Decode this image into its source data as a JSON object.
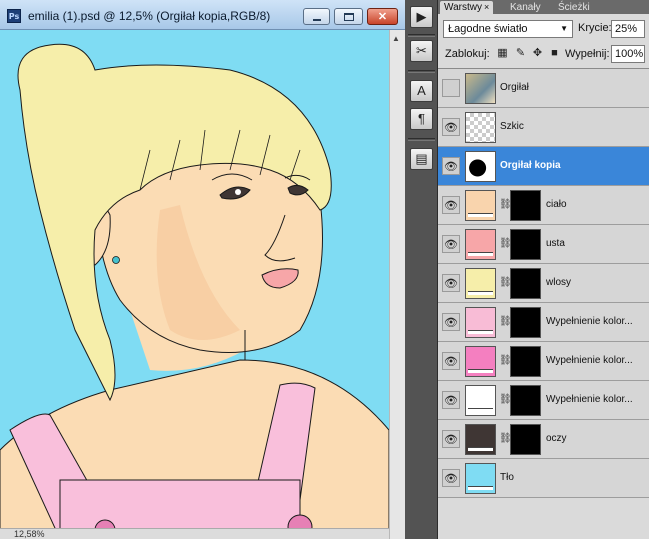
{
  "document": {
    "title": "emilia (1).psd @ 12,5% (Orgiłał kopia,RGB/8)",
    "app_icon": "Ps",
    "zoom": "12,58%",
    "canvas_bg": "#7fdcf3"
  },
  "tools": [
    {
      "icon": "play-icon",
      "glyph": "▶"
    },
    {
      "icon": "brush-tools-icon",
      "glyph": "✂"
    },
    {
      "icon": "text-tool-icon",
      "glyph": "A"
    },
    {
      "icon": "paragraph-icon",
      "glyph": "¶"
    },
    {
      "icon": "panel-icon",
      "glyph": "▤"
    }
  ],
  "panel": {
    "tabs": [
      {
        "label": "Warstwy",
        "active": true,
        "close": "×"
      },
      {
        "label": "Kanały",
        "active": false
      },
      {
        "label": "Ścieżki",
        "active": false
      }
    ],
    "blend_mode": "Łagodne światło",
    "opacity_label": "Krycie:",
    "opacity": "25%",
    "lock_label": "Zablokuj:",
    "fill_label": "Wypełnij:",
    "fill": "100%"
  },
  "layers": [
    {
      "name": "Orgiłał",
      "visible": false,
      "thumb": "photo",
      "mask": false,
      "selected": false
    },
    {
      "name": "Szkic",
      "visible": true,
      "thumb": "checker",
      "mask": false,
      "selected": false
    },
    {
      "name": "Orgiłał kopia",
      "visible": true,
      "thumb": "bw",
      "mask": false,
      "selected": true
    },
    {
      "name": "ciało",
      "visible": true,
      "thumb": "#f9d4ad",
      "mask": true,
      "selected": false
    },
    {
      "name": "usta",
      "visible": true,
      "thumb": "#f7a6a8",
      "mask": true,
      "selected": false
    },
    {
      "name": "wlosy",
      "visible": true,
      "thumb": "#f6eeaa",
      "mask": true,
      "selected": false
    },
    {
      "name": "Wypełnienie kolor...",
      "visible": true,
      "thumb": "#f8bcd6",
      "mask": true,
      "selected": false
    },
    {
      "name": "Wypełnienie kolor...",
      "visible": true,
      "thumb": "#f47fc0",
      "mask": true,
      "selected": false
    },
    {
      "name": "Wypełnienie kolor...",
      "visible": true,
      "thumb": "#ffffff",
      "mask": true,
      "selected": false
    },
    {
      "name": "oczy",
      "visible": true,
      "thumb": "#3f3634",
      "mask": true,
      "selected": false
    },
    {
      "name": "Tło",
      "visible": true,
      "thumb": "#7fdcf3",
      "mask": false,
      "selected": false
    }
  ]
}
